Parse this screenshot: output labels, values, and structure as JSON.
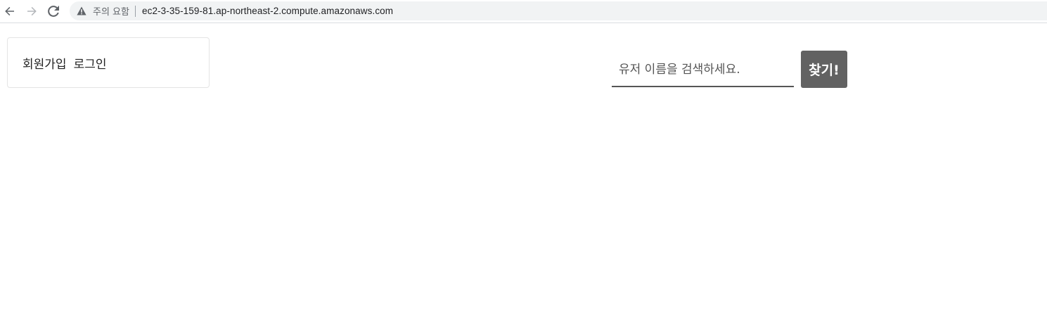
{
  "browser": {
    "security_label": "주의 요함",
    "url": "ec2-3-35-159-81.ap-northeast-2.compute.amazonaws.com",
    "icons": {
      "back": "back-arrow-icon",
      "forward": "forward-arrow-icon",
      "reload": "reload-icon",
      "security": "warning-triangle-icon"
    }
  },
  "auth": {
    "signup_label": "회원가입",
    "login_label": "로그인"
  },
  "search": {
    "placeholder": "유저 이름을 검색하세요.",
    "value": "",
    "button_label": "찾기!"
  },
  "colors": {
    "button_bg": "#626262",
    "button_text": "#ffffff",
    "input_underline": "#555555",
    "omnibox_bg": "#f1f3f4"
  }
}
